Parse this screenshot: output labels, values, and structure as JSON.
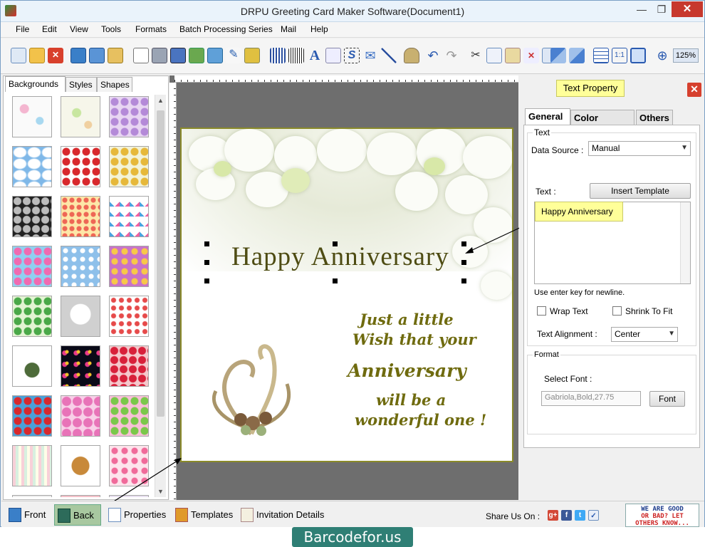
{
  "window": {
    "title": "DRPU Greeting Card Maker Software(Document1)",
    "minimize": "—",
    "restore": "❐",
    "close": "✕"
  },
  "menu": [
    "File",
    "Edit",
    "View",
    "Tools",
    "Formats",
    "Batch Processing Series",
    "Mail",
    "Help"
  ],
  "toolbar": {
    "zoom": "125%",
    "icons": [
      "new-icon",
      "open-icon",
      "close-doc-icon",
      "save-icon",
      "save-as-icon",
      "export-icon",
      "properties-icon",
      "print-icon",
      "print-preview-icon",
      "crop-icon",
      "image-icon",
      "pencil-icon",
      "shape-icon",
      "barcode-icon",
      "barcode2-icon",
      "text-icon",
      "word-art-icon",
      "signature-icon",
      "email-icon",
      "line-icon",
      "database-icon",
      "undo-icon",
      "redo-icon",
      "cut-icon",
      "copy-icon",
      "paste-icon",
      "delete-icon",
      "paste-special-icon",
      "bring-front-icon",
      "send-back-icon",
      "grid-icon",
      "actual-size-icon",
      "fit-icon",
      "zoom-in-icon"
    ]
  },
  "left_panel": {
    "tabs": [
      "Backgrounds",
      "Styles",
      "Shapes"
    ],
    "active_tab": "Backgrounds"
  },
  "card": {
    "title_text": "Happy  Anniversary",
    "verse": [
      "Just a little",
      "Wish that your",
      "Anniversary",
      "will be a",
      "wonderful one !"
    ]
  },
  "right_panel": {
    "header": "Text Property",
    "close": "✕",
    "tabs": [
      "General",
      "Color Effects",
      "Others"
    ],
    "active_tab": "General",
    "text_group": "Text",
    "data_source_label": "Data Source :",
    "data_source_value": "Manual",
    "text_label": "Text :",
    "insert_template": "Insert Template",
    "text_value": "Happy  Anniversary",
    "hint": "Use enter key for newline.",
    "wrap_text": "Wrap Text",
    "shrink_to_fit": "Shrink To Fit",
    "alignment_label": "Text Alignment :",
    "alignment_value": "Center",
    "format_group": "Format",
    "select_font_label": "Select Font :",
    "font_value": "Gabriola,Bold,27.75",
    "font_button": "Font"
  },
  "statusbar": {
    "front": "Front",
    "back": "Back",
    "properties": "Properties",
    "templates": "Templates",
    "invitation": "Invitation Details",
    "share": "Share Us On :",
    "social": [
      "g+",
      "f",
      "t",
      "✓"
    ],
    "feedback": [
      "WE ARE GOOD",
      "OR BAD? LET",
      "OTHERS KNOW..."
    ]
  },
  "watermark": "Barcodefor.us",
  "colors": {
    "card_text": "#6a6611",
    "callout": "#ffff99",
    "close": "#c7382d"
  }
}
